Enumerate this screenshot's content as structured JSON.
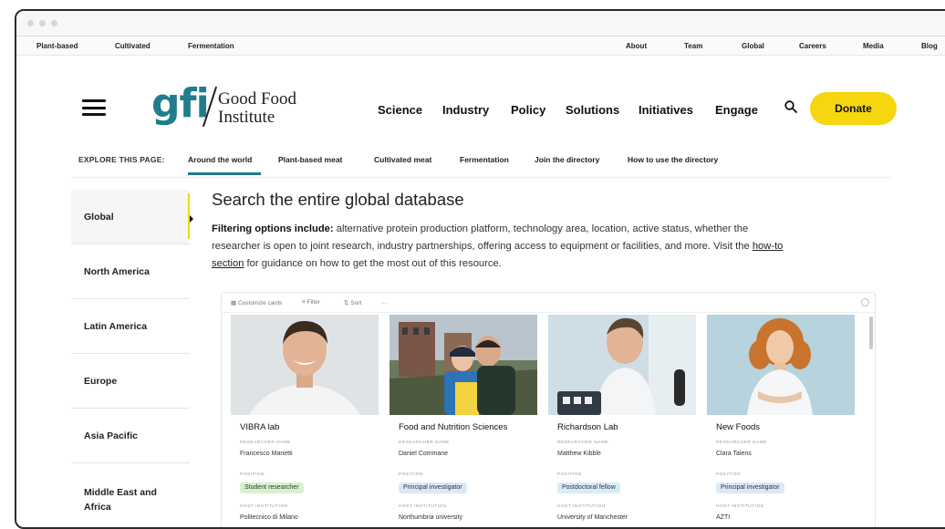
{
  "top_nav": {
    "left": [
      "Plant-based",
      "Cultivated",
      "Fermentation"
    ],
    "right": [
      "About",
      "Team",
      "Global",
      "Careers",
      "Media",
      "Blog"
    ]
  },
  "logo": {
    "mark": "gfi",
    "name_line1": "Good Food",
    "name_line2": "Institute"
  },
  "main_nav": [
    "Science",
    "Industry",
    "Policy",
    "Solutions",
    "Initiatives",
    "Engage"
  ],
  "donate_label": "Donate",
  "explore": {
    "label": "EXPLORE THIS PAGE:",
    "links": [
      "Around the world",
      "Plant-based meat",
      "Cultivated meat",
      "Fermentation",
      "Join the directory",
      "How to use the directory"
    ],
    "active_index": 0
  },
  "sidebar": {
    "items": [
      "Global",
      "North America",
      "Latin America",
      "Europe",
      "Asia Pacific",
      "Middle East and Africa"
    ],
    "active_index": 0
  },
  "content": {
    "heading": "Search the entire global database",
    "para_bold": "Filtering options include:",
    "para_text1": " alternative protein production platform, technology area, location, active status, whether the researcher is open to joint research, industry partnerships, offering access to equipment or facilities, and more. Visit the ",
    "para_link": "how-to section",
    "para_text2": " for guidance on how to get the most out of this resource."
  },
  "toolbar": {
    "customize": "Customize cards",
    "filter": "Filter",
    "sort": "Sort",
    "more": "…"
  },
  "field_labels": {
    "researcher": "RESEARCHER NAME",
    "position": "POSITION",
    "institution": "HOST INSTITUTION"
  },
  "cards": [
    {
      "title": "VIBRA lab",
      "researcher": "Francesco Manetti",
      "position": "Student researcher",
      "institution": "Politecnico di Milano",
      "pill_color": "#d9f0cf"
    },
    {
      "title": "Food and Nutrition Sciences",
      "researcher": "Daniel Commane",
      "position": "Principal investigator",
      "institution": "Northumbria university",
      "pill_color": "#dbe8f7"
    },
    {
      "title": "Richardson Lab",
      "researcher": "Matthew Kibble",
      "position": "Postdoctoral fellow",
      "institution": "University of Manchester",
      "pill_color": "#d6ecf7"
    },
    {
      "title": "New Foods",
      "researcher": "Clara Talens",
      "position": "Principal investigator",
      "institution": "AZTI",
      "pill_color": "#dbe8f7"
    }
  ],
  "colors": {
    "brand_teal": "#1f7d8c",
    "donate_yellow": "#f6d60e"
  }
}
